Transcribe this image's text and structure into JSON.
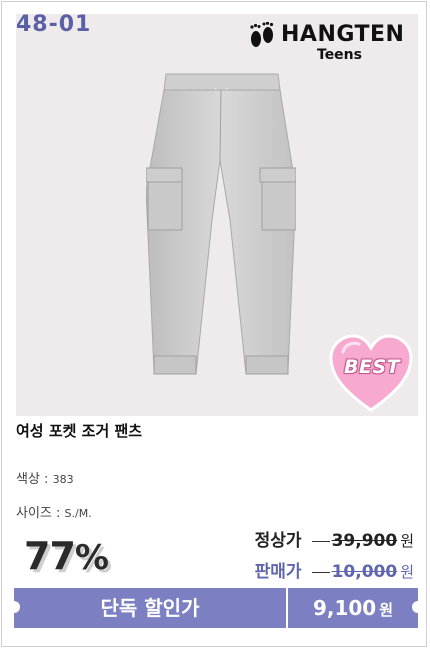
{
  "product": {
    "code": "48-01",
    "brand_name": "HANGTEN",
    "brand_sub": "Teens",
    "badge": "BEST",
    "title": "여성 포켓 조거 팬츠"
  },
  "specs": {
    "color_label": "색상 :",
    "color_value": "383",
    "size_label": "사이즈 :",
    "size_value": "S./M."
  },
  "discount": {
    "percent": "77",
    "percent_sign": "%"
  },
  "prices": {
    "regular_label": "정상가",
    "regular_value": "39,900",
    "sale_label": "판매가",
    "sale_value": "10,000",
    "currency": "원"
  },
  "cta": {
    "label": "단독 할인가",
    "price": "9,100",
    "currency": "원"
  },
  "colors": {
    "accent": "#7c80c2",
    "code_text": "#5b5fa6",
    "badge_pink": "#f7a9cf",
    "photo_bg": "#efeaeb"
  },
  "icons": {
    "brand": "footprints-icon",
    "badge": "heart-badge-icon"
  }
}
